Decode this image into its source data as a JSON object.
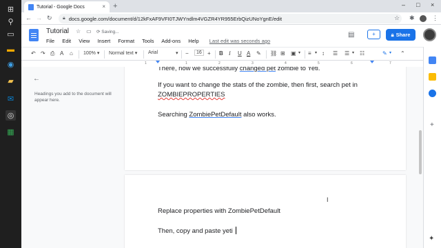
{
  "taskbar": {
    "icons": [
      "windows-start",
      "search",
      "task-view",
      "edge",
      "file-explorer",
      "mail",
      "chrome",
      "sheets"
    ]
  },
  "browser": {
    "tab_title": "Tutorial - Google Docs",
    "tab_close": "×",
    "new_tab": "+",
    "url": "docs.google.com/document/d/12kFxAF9VFI0TJWYndlm4VGZR4YR955ErbQizUNoYgnE/edit",
    "window_controls": [
      "–",
      "□",
      "×"
    ]
  },
  "docs": {
    "title": "Tutorial",
    "saving_status": "Saving...",
    "menu": [
      "File",
      "Edit",
      "View",
      "Insert",
      "Format",
      "Tools",
      "Add-ons",
      "Help"
    ],
    "last_edit": "Last edit was seconds ago",
    "share_label": "Share"
  },
  "toolbar": {
    "zoom": "100%",
    "style": "Normal text",
    "font": "Arial",
    "font_size": "16",
    "font_minus": "−",
    "font_plus": "+"
  },
  "ruler": {
    "ticks": [
      "1",
      "1",
      "2",
      "3",
      "4",
      "5",
      "6",
      "7"
    ]
  },
  "outline": {
    "hint": "Headings you add to the document will appear here."
  },
  "document": {
    "page1": {
      "line1_a": "There, now we successfully ",
      "line1_b": "changed pet",
      "line1_c": " zombie to Yeti.",
      "para2_a": "If you want to change the stats of the zombie, then first, search pet in ",
      "para2_b": "ZOMBIEPROPERTIES",
      "para3_a": "Searching ",
      "para3_b": "ZombiePetDefault",
      "para3_c": " also works."
    },
    "page2": {
      "line1": "Replace properties with ZombiePetDefault",
      "line2": "Then, copy and paste yeti "
    }
  },
  "colors": {
    "accent": "#1a73e8",
    "spellcheck": "#e53935"
  }
}
